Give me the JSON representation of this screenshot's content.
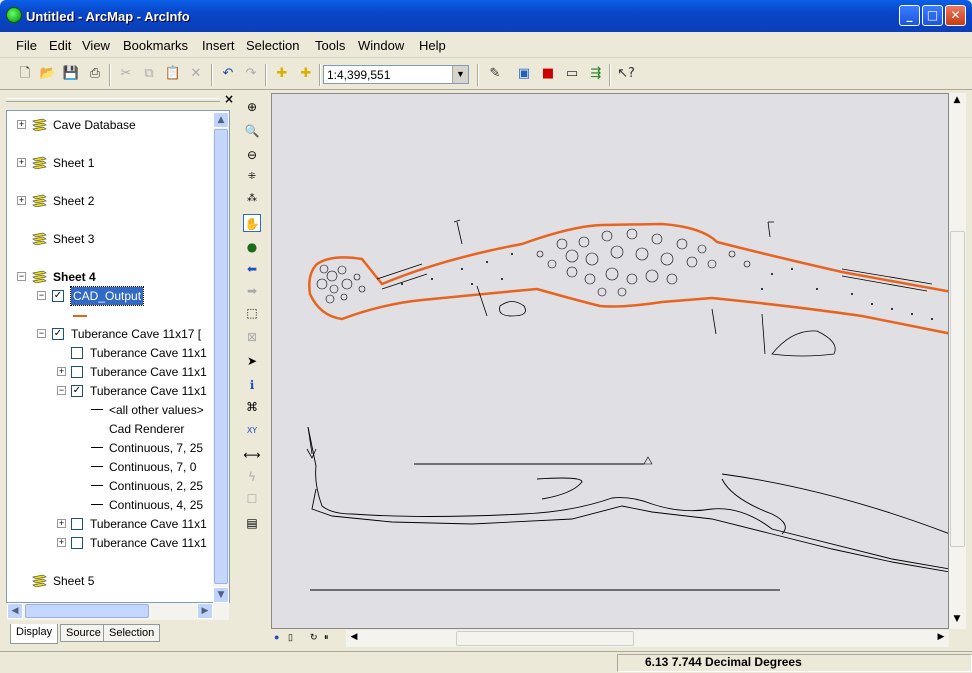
{
  "window": {
    "title": "Untitled - ArcMap - ArcInfo"
  },
  "menu": [
    "File",
    "Edit",
    "View",
    "Bookmarks",
    "Insert",
    "Selection",
    "Tools",
    "Window",
    "Help"
  ],
  "toolbar": {
    "scale_value": "1:4,399,551"
  },
  "toc": {
    "layers": [
      {
        "label": "Cave Database",
        "level": 0,
        "expander": "+",
        "bold": false
      },
      {
        "label": "Sheet 1",
        "level": 0,
        "expander": "+",
        "bold": false
      },
      {
        "label": "Sheet 2",
        "level": 0,
        "expander": "+",
        "bold": false
      },
      {
        "label": "Sheet 3",
        "level": 0,
        "expander": "",
        "bold": false
      },
      {
        "label": "Sheet 4",
        "level": 0,
        "expander": "-",
        "bold": true
      },
      {
        "label": "CAD_Output",
        "level": 1,
        "expander": "-",
        "checked": true,
        "selected": true
      },
      {
        "label": "Tuberance Cave 11x17 [",
        "level": 1,
        "expander": "-",
        "checked": true
      },
      {
        "label": "Tuberance Cave 11x1",
        "level": 2,
        "expander": "",
        "checked": false
      },
      {
        "label": "Tuberance Cave 11x1",
        "level": 2,
        "expander": "+",
        "checked": false
      },
      {
        "label": "Tuberance Cave 11x1",
        "level": 2,
        "expander": "-",
        "checked": true
      },
      {
        "label": "<all other values>",
        "level": 3,
        "dash": true
      },
      {
        "label": "Cad Renderer",
        "level": 3,
        "dash": false
      },
      {
        "label": "Continuous, 7, 25",
        "level": 3,
        "dash": true
      },
      {
        "label": "Continuous, 7, 0",
        "level": 3,
        "dash": true
      },
      {
        "label": "Continuous, 2, 25",
        "level": 3,
        "dash": true
      },
      {
        "label": "Continuous, 4, 25",
        "level": 3,
        "dash": true
      },
      {
        "label": "Tuberance Cave 11x1",
        "level": 2,
        "expander": "+",
        "checked": false
      },
      {
        "label": "Tuberance Cave 11x1",
        "level": 2,
        "expander": "+",
        "checked": false
      },
      {
        "label": "Sheet 5",
        "level": 0,
        "expander": "",
        "bold": false
      }
    ],
    "tabs": [
      "Display",
      "Source",
      "Selection"
    ],
    "active_tab": "Display"
  },
  "statusbar": {
    "coordinates": "6.13  7.744 Decimal Degrees"
  },
  "colors": {
    "highlight": "#e8631e",
    "selection": "#316ac5"
  }
}
